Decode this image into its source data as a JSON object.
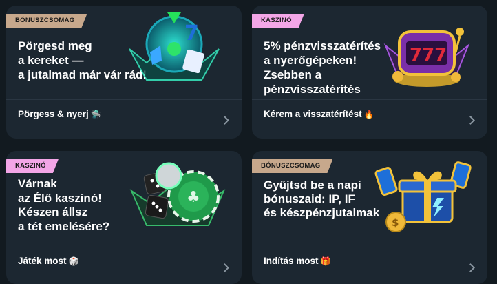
{
  "cards": [
    {
      "tag": "BÓNUSZCSOMAG",
      "tag_color": "#c7a88c",
      "title": "Pörgesd meg\na kereket —\na jutalmad már vár rád!",
      "cta": "Pörgess & nyerj",
      "cta_icon": "🛸",
      "art_icon": "wheel-icon"
    },
    {
      "tag": "KASZINÓ",
      "tag_color": "#f3a6e7",
      "title": "5% pénzvisszatérítés\na nyerőgépeken!\nZsebben a\npénzvisszatérítés",
      "cta": "Kérem a visszatérítést",
      "cta_icon": "🔥",
      "art_icon": "slot-machine-icon"
    },
    {
      "tag": "KASZINÓ",
      "tag_color": "#f3a6e7",
      "title": "Várnak\naz Élő kaszinó!\nKészen állsz\na tét emelésére?",
      "cta": "Játék most",
      "cta_icon": "🎲",
      "art_icon": "dice-chips-icon"
    },
    {
      "tag": "BÓNUSZCSOMAG",
      "tag_color": "#c7a88c",
      "title": "Gyűjtsd be a napi\nbónuszaid: IP, IF\nés készpénzjutalmak",
      "cta": "Indítás most",
      "cta_icon": "🎁",
      "art_icon": "gift-box-icon"
    }
  ]
}
